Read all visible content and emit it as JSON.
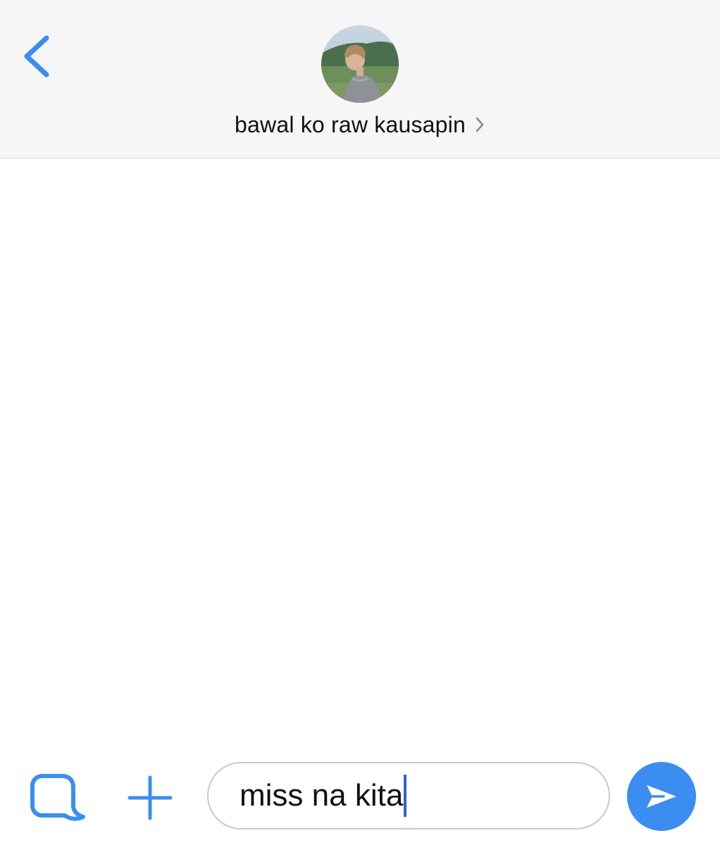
{
  "colors": {
    "accent": "#3b8df2",
    "header_bg": "#f6f6f6",
    "caret": "#3b5bdb"
  },
  "header": {
    "back_icon": "chevron-left-icon",
    "contact_name": "bawal ko raw kausapin",
    "name_chevron_icon": "chevron-right-icon",
    "avatar_icon": "profile-photo"
  },
  "composer": {
    "sticker_icon": "speech-bubble-icon",
    "plus_icon": "plus-icon",
    "message_value": "miss na kita",
    "send_icon": "send-arrow-icon"
  }
}
